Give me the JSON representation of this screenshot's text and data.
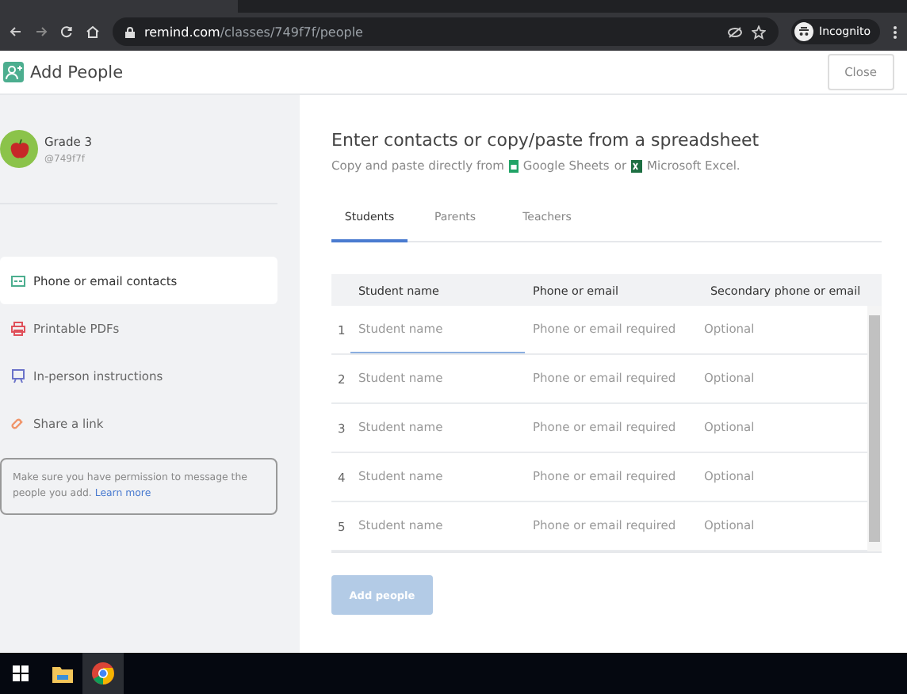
{
  "browser": {
    "url_host": "remind.com",
    "url_path": "/classes/749f7f/people",
    "profile": "Incognito"
  },
  "header": {
    "title": "Add People",
    "close": "Close"
  },
  "class": {
    "name": "Grade 3",
    "code": "@749f7f"
  },
  "nav": [
    {
      "label": "Phone or email contacts",
      "selected": true,
      "kind": "contacts"
    },
    {
      "label": "Printable PDFs",
      "selected": false,
      "kind": "print"
    },
    {
      "label": "In-person instructions",
      "selected": false,
      "kind": "instructions"
    },
    {
      "label": "Share a link",
      "selected": false,
      "kind": "link"
    }
  ],
  "notice": {
    "text": "Make sure you have permission to message the people you add.",
    "link": "Learn more"
  },
  "main": {
    "heading": "Enter contacts or copy/paste from a spreadsheet",
    "lead": "Copy and paste directly from",
    "sheets": "Google Sheets",
    "joiner": "or",
    "excel": "Microsoft Excel."
  },
  "tabs": [
    {
      "label": "Students",
      "selected": true
    },
    {
      "label": "Parents",
      "selected": false
    },
    {
      "label": "Teachers",
      "selected": false
    }
  ],
  "columns": [
    "Student name",
    "Phone or email",
    "Secondary phone or email"
  ],
  "rows": [
    {
      "number": "1",
      "focused": true,
      "fields": [
        {
          "placeholder": "Student name"
        },
        {
          "placeholder": "Phone or email required"
        },
        {
          "placeholder": "Optional"
        }
      ]
    },
    {
      "number": "2",
      "focused": false,
      "fields": [
        {
          "placeholder": "Student name"
        },
        {
          "placeholder": "Phone or email required"
        },
        {
          "placeholder": "Optional"
        }
      ]
    },
    {
      "number": "3",
      "focused": false,
      "fields": [
        {
          "placeholder": "Student name"
        },
        {
          "placeholder": "Phone or email required"
        },
        {
          "placeholder": "Optional"
        }
      ]
    },
    {
      "number": "4",
      "focused": false,
      "fields": [
        {
          "placeholder": "Student name"
        },
        {
          "placeholder": "Phone or email required"
        },
        {
          "placeholder": "Optional"
        }
      ]
    },
    {
      "number": "5",
      "focused": false,
      "fields": [
        {
          "placeholder": "Student name"
        },
        {
          "placeholder": "Phone or email required"
        },
        {
          "placeholder": "Optional"
        }
      ]
    }
  ],
  "submit": {
    "label": "Add people",
    "disabled": true
  }
}
